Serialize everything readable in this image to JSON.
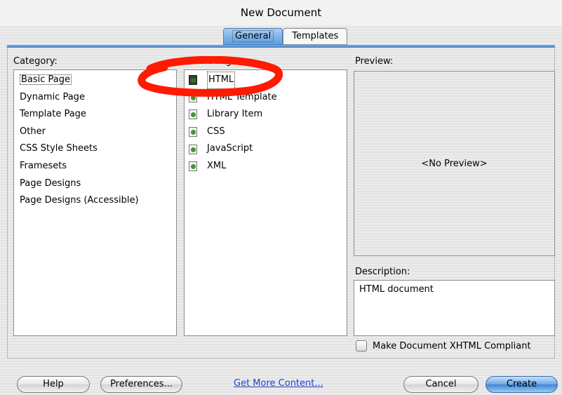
{
  "window": {
    "title": "New Document"
  },
  "tabs": [
    {
      "label": "General",
      "active": true
    },
    {
      "label": "Templates",
      "active": false
    }
  ],
  "category": {
    "label": "Category:",
    "items": [
      "Basic Page",
      "Dynamic Page",
      "Template Page",
      "Other",
      "CSS Style Sheets",
      "Framesets",
      "Page Designs",
      "Page Designs (Accessible)"
    ],
    "selected": "Basic Page"
  },
  "basic_page": {
    "label": "Basic Page:",
    "items": [
      {
        "label": "HTML",
        "icon": "dreamweaver-html-file-icon"
      },
      {
        "label": "HTML Template",
        "icon": "dreamweaver-file-icon"
      },
      {
        "label": "Library Item",
        "icon": "dreamweaver-file-icon"
      },
      {
        "label": "CSS",
        "icon": "dreamweaver-file-icon"
      },
      {
        "label": "JavaScript",
        "icon": "dreamweaver-file-icon"
      },
      {
        "label": "XML",
        "icon": "dreamweaver-file-icon"
      }
    ],
    "selected": "HTML"
  },
  "preview": {
    "label": "Preview:",
    "text": "<No Preview>"
  },
  "description": {
    "label": "Description:",
    "text": "HTML document"
  },
  "xhtml": {
    "label": "Make Document XHTML Compliant",
    "checked": false
  },
  "buttons": {
    "help": "Help",
    "preferences": "Preferences...",
    "get_more": "Get More Content...",
    "cancel": "Cancel",
    "create": "Create"
  },
  "colors": {
    "annotation": "#ff1a00",
    "link": "#1f3fd6",
    "accent": "#5d9ee0"
  }
}
